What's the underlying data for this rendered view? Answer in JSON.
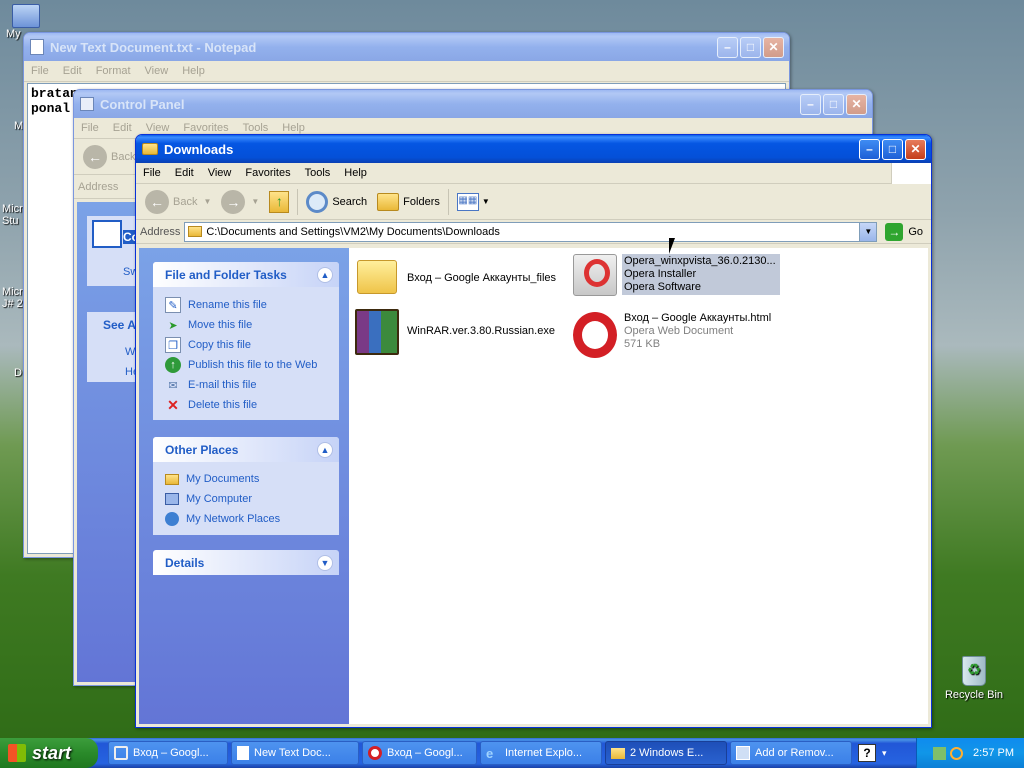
{
  "desktop": {
    "icons": [
      {
        "label": "My"
      },
      {
        "label": "M"
      },
      {
        "label": "Micro"
      },
      {
        "label": "Stu"
      },
      {
        "label": "Micro"
      },
      {
        "label": "J# 2"
      },
      {
        "label": "D"
      },
      {
        "label": "Recycle Bin"
      }
    ]
  },
  "notepad": {
    "title": "New Text Document.txt - Notepad",
    "menu": [
      "File",
      "Edit",
      "Format",
      "View",
      "Help"
    ],
    "lines": [
      "bratan",
      "ponal"
    ]
  },
  "control_panel": {
    "title": "Control Panel",
    "menu": [
      "File",
      "Edit",
      "View",
      "Favorites",
      "Tools",
      "Help"
    ],
    "back_label": "Back",
    "address_label": "Address",
    "panel_title": "Co",
    "switch_label": "Sw",
    "see_also": "See A",
    "links": [
      "W",
      "He"
    ]
  },
  "explorer": {
    "title": "Downloads",
    "menu": [
      "File",
      "Edit",
      "View",
      "Favorites",
      "Tools",
      "Help"
    ],
    "toolbar": {
      "back": "Back",
      "search": "Search",
      "folders": "Folders"
    },
    "address_label": "Address",
    "address_value": "C:\\Documents and Settings\\VM2\\My Documents\\Downloads",
    "go_label": "Go",
    "file_tasks": {
      "title": "File and Folder Tasks",
      "items": [
        "Rename this file",
        "Move this file",
        "Copy this file",
        "Publish this file to the Web",
        "E-mail this file",
        "Delete this file"
      ]
    },
    "other_places": {
      "title": "Other Places",
      "items": [
        "My Documents",
        "My Computer",
        "My Network Places"
      ]
    },
    "details": {
      "title": "Details"
    },
    "files": [
      {
        "name": "Вход – Google Аккаунты_files",
        "line2": "",
        "line3": ""
      },
      {
        "name": "Opera_winxpvista_36.0.2130...",
        "line2": "Opera Installer",
        "line3": "Opera Software"
      },
      {
        "name": "WinRAR.ver.3.80.Russian.exe",
        "line2": "",
        "line3": ""
      },
      {
        "name": "Вход – Google Аккаунты.html",
        "line2": "Opera Web Document",
        "line3": "571 KB"
      }
    ]
  },
  "taskbar": {
    "start_label": "start",
    "items": [
      "Вход – Googl...",
      "New Text Doc...",
      "Вход – Googl...",
      "Internet Explo...",
      "2 Windows E...",
      "Add or Remov..."
    ],
    "clock": "2:57 PM"
  },
  "colors": {
    "accent": "#0a5fe8",
    "task_link": "#215dc6",
    "selection": "#c1c9d9"
  }
}
